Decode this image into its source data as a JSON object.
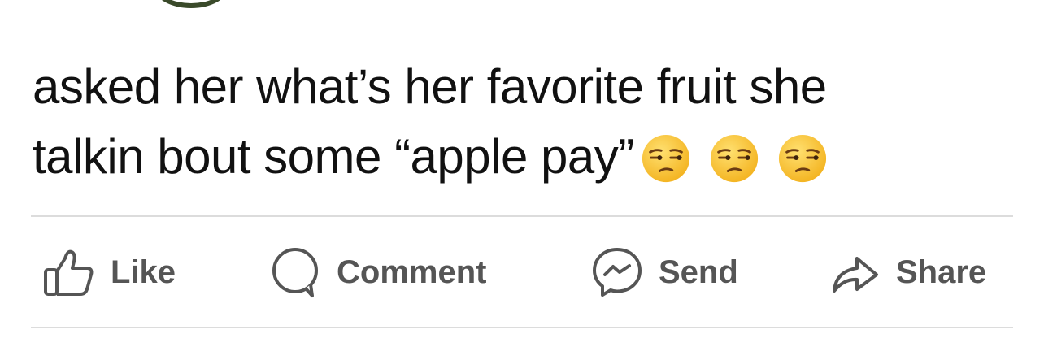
{
  "post": {
    "line1": "asked her what’s her favorite fruit she",
    "line2": "talkin bout some “apple pay”",
    "emoji": [
      "unamused-face",
      "unamused-face",
      "unamused-face"
    ]
  },
  "actions": {
    "like_label": "Like",
    "comment_label": "Comment",
    "send_label": "Send",
    "share_label": "Share"
  },
  "colors": {
    "text": "#111111",
    "action_label": "#555555",
    "divider": "#dcdcdc",
    "emoji_face": "#f7c23a"
  }
}
